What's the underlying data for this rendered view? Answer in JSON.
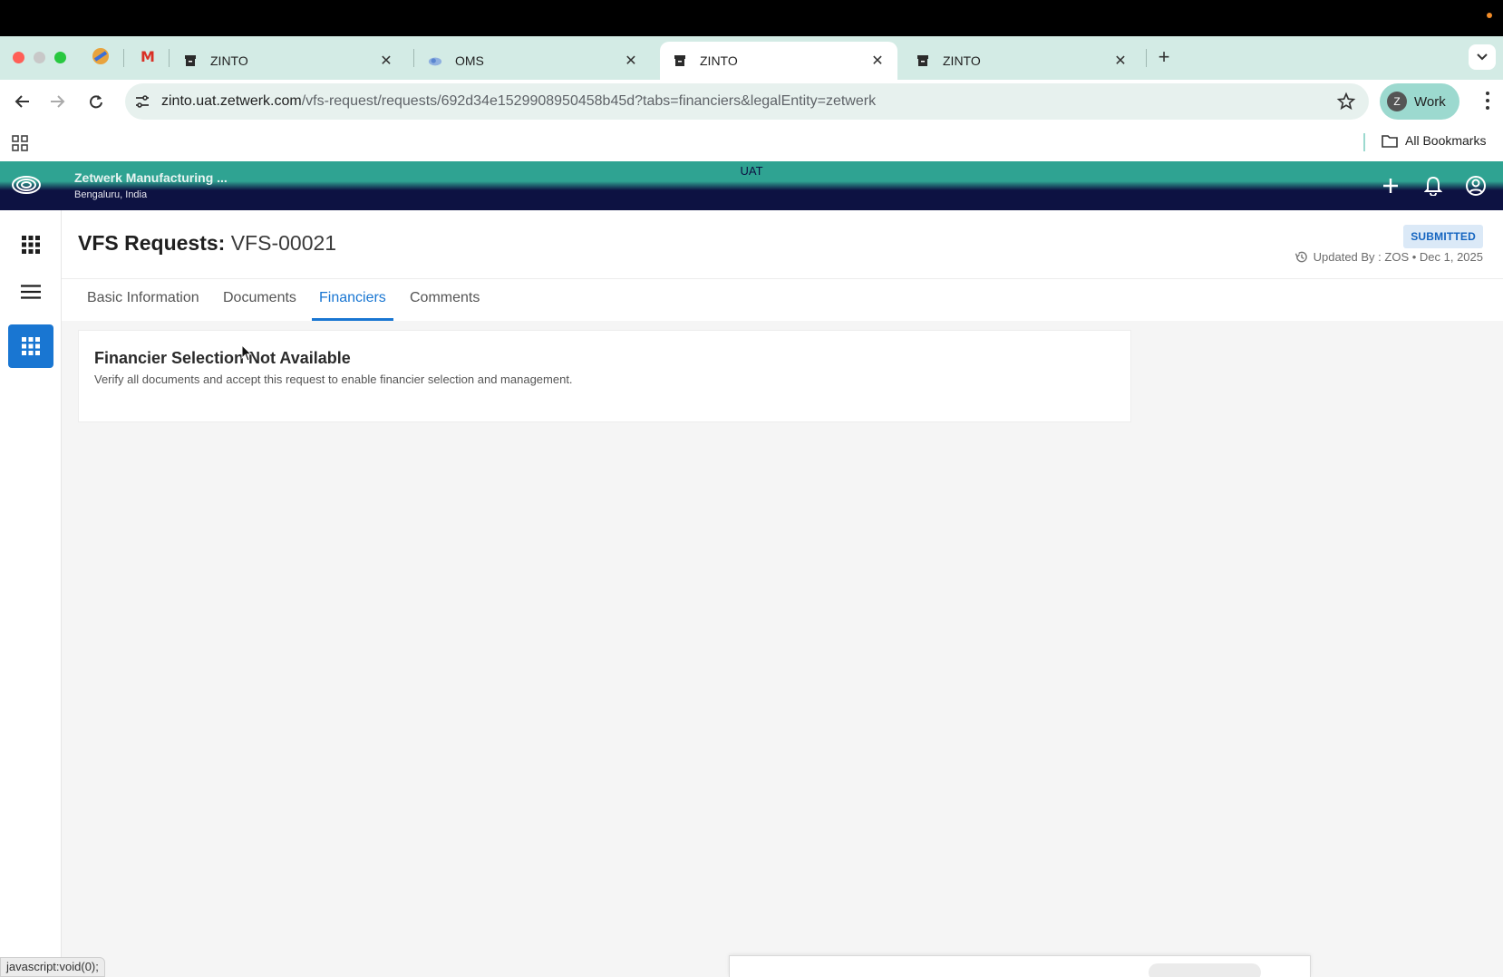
{
  "browser": {
    "tabs": [
      {
        "title": "ZINTO",
        "active": false
      },
      {
        "title": "OMS",
        "active": false
      },
      {
        "title": "ZINTO",
        "active": true
      },
      {
        "title": "ZINTO",
        "active": false
      }
    ],
    "url_host": "zinto.uat.zetwerk.com",
    "url_path": "/vfs-request/requests/692d34e1529908950458b45d?tabs=financiers&legalEntity=zetwerk",
    "profile_initial": "Z",
    "profile_label": "Work",
    "all_bookmarks": "All Bookmarks"
  },
  "app": {
    "env_label": "UAT",
    "company_name": "Zetwerk Manufacturing ...",
    "company_location": "Bengaluru, India"
  },
  "page": {
    "title_label": "VFS Requests:",
    "title_id": "VFS-00021",
    "status": "SUBMITTED",
    "updated_by": "Updated By : ZOS • Dec 1, 2025",
    "tabs": [
      "Basic Information",
      "Documents",
      "Financiers",
      "Comments"
    ],
    "active_tab": "Financiers"
  },
  "card": {
    "title": "Financier Selection Not Available",
    "description": "Verify all documents and accept this request to enable financier selection and management."
  },
  "status_bar_url": "javascript:void(0);",
  "colors": {
    "accent": "#1976d2",
    "header_navy": "#0d1242",
    "env_teal": "#2fa392",
    "tabstrip": "#d3ebe5"
  }
}
